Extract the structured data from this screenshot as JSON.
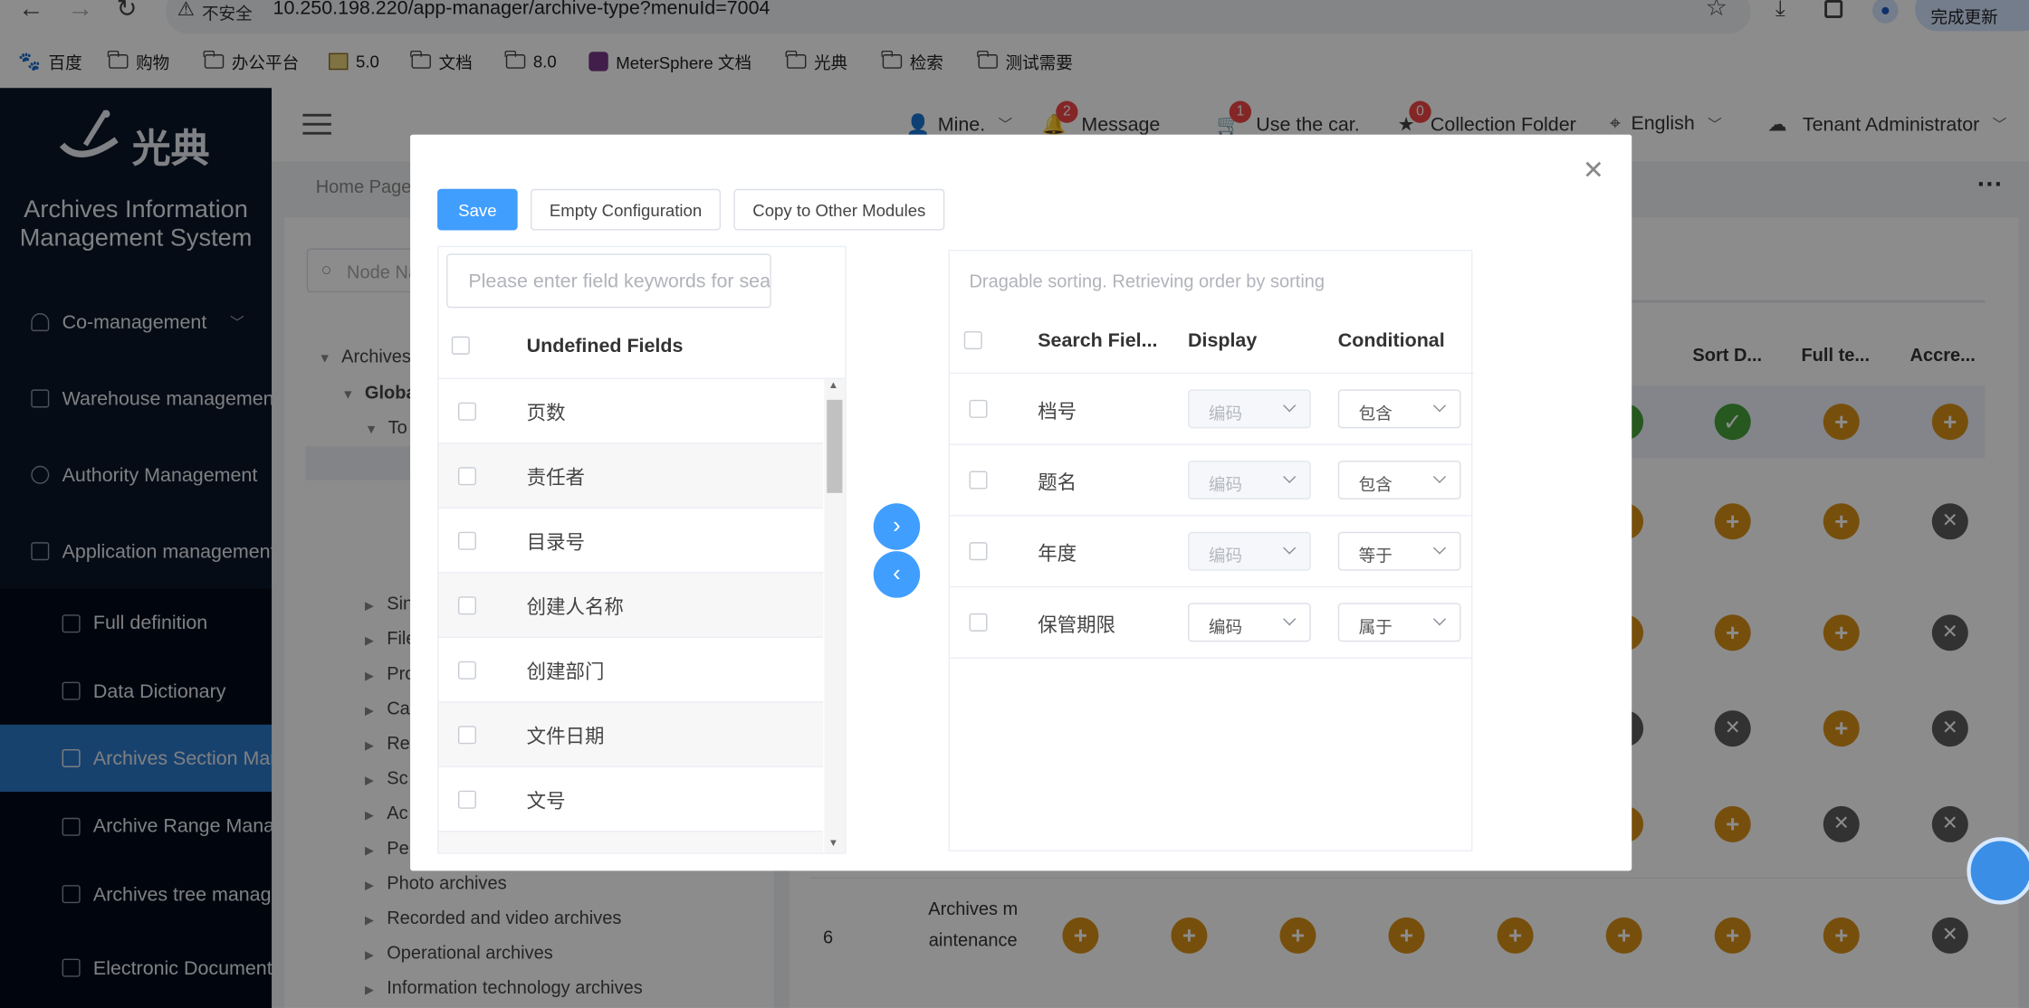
{
  "browser": {
    "insecure_label": "不安全",
    "url": "10.250.198.220/app-manager/archive-type?menuId=7004",
    "update_button": "完成更新",
    "bookmarks": [
      "百度",
      "购物",
      "办公平台",
      "5.0",
      "文档",
      "8.0",
      "MeterSphere 文档",
      "光典",
      "检索",
      "测试需要"
    ]
  },
  "app": {
    "logo_text": "光典",
    "system_title_line1": "Archives Information",
    "system_title_line2": "Management System"
  },
  "sidebar": {
    "items": [
      {
        "label": "Co-management"
      },
      {
        "label": "Warehouse management"
      },
      {
        "label": "Authority Management"
      },
      {
        "label": "Application management"
      }
    ],
    "subitems": [
      {
        "label": "Full definition",
        "active": false
      },
      {
        "label": "Data Dictionary",
        "active": false
      },
      {
        "label": "Archives Section Management",
        "active": true
      },
      {
        "label": "Archive Range Management",
        "active": false
      },
      {
        "label": "Archives tree management",
        "active": false
      },
      {
        "label": "Electronic Document Management",
        "active": false
      }
    ]
  },
  "header": {
    "user": "Mine.",
    "message": {
      "label": "Message",
      "count": "2"
    },
    "car": {
      "label": "Use the car.",
      "count": "1"
    },
    "collection": {
      "label": "Collection Folder",
      "count": "0"
    },
    "language": "English",
    "tenant": "Tenant Administrator"
  },
  "page": {
    "breadcrumb": "Home Page",
    "search_placeholder": "Node Name",
    "tree": {
      "root": "Archives",
      "global": "Global",
      "to": "To",
      "partial": [
        "Sin",
        "File",
        "Pro",
        "Ca",
        "Re",
        "Sc",
        "Ac",
        "Pe"
      ],
      "nodes": [
        "Photo archives",
        "Recorded and video archives",
        "Operational archives",
        "Information technology archives"
      ]
    },
    "table": {
      "headers": [
        "...",
        "Sort D...",
        "Full te...",
        "Accre..."
      ],
      "last_row_index": "6",
      "last_row_name": "Archives maintenance"
    }
  },
  "modal": {
    "save": "Save",
    "empty_config": "Empty Configuration",
    "copy": "Copy to Other Modules",
    "left": {
      "placeholder": "Please enter field keywords for search",
      "header": "Undefined Fields",
      "rows": [
        "页数",
        "责任者",
        "目录号",
        "创建人名称",
        "创建部门",
        "文件日期",
        "文号"
      ]
    },
    "right": {
      "hint": "Dragable sorting. Retrieving order by sorting",
      "headers": [
        "Search Fiel...",
        "Display",
        "Conditional"
      ],
      "rows": [
        {
          "field": "档号",
          "display": "编码",
          "condition": "包含",
          "disabled": true
        },
        {
          "field": "题名",
          "display": "编码",
          "condition": "包含",
          "disabled": true
        },
        {
          "field": "年度",
          "display": "编码",
          "condition": "等于",
          "disabled": true
        },
        {
          "field": "保管期限",
          "display": "编码",
          "condition": "属于",
          "disabled": false
        }
      ]
    }
  },
  "colors": {
    "primary": "#409eff",
    "sidebar": "#0a1628",
    "active": "#2c79c9",
    "orange": "#d99118",
    "green": "#45a03a",
    "gray": "#5c5c5c"
  }
}
